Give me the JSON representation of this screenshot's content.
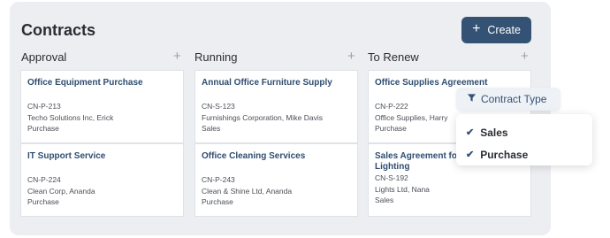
{
  "title": "Contracts",
  "create_label": "Create",
  "columns": [
    {
      "name": "Approval"
    },
    {
      "name": "Running"
    },
    {
      "name": "To Renew"
    }
  ],
  "cards": {
    "approval": [
      {
        "title": "Office Equipment Purchase",
        "id": "CN-P-213",
        "party": "Techo Solutions Inc, Erick",
        "type": "Purchase"
      },
      {
        "title": "IT Support Service",
        "id": "CN-P-224",
        "party": "Clean Corp, Ananda",
        "type": "Purchase"
      }
    ],
    "running": [
      {
        "title": "Annual Office Furniture Supply",
        "id": "CN-S-123",
        "party": "Furnishings Corporation, Mike Davis",
        "type": "Sales"
      },
      {
        "title": "Office Cleaning Services",
        "id": "CN-P-243",
        "party": "Clean & Shine Ltd, Ananda",
        "type": "Purchase"
      }
    ],
    "renew": [
      {
        "title": "Office Supplies Agreement",
        "id": "CN-P-222",
        "party": "Office Supplies, Harry",
        "type": "Purchase"
      },
      {
        "title_line1": "Sales Agreement fo",
        "title_line2": "Lighting",
        "id": "CN-S-192",
        "party": "Lights Ltd, Nana",
        "type": "Sales"
      }
    ]
  },
  "filter": {
    "label": "Contract Type",
    "options": [
      {
        "label": "Sales",
        "checked": true
      },
      {
        "label": "Purchase",
        "checked": true
      }
    ]
  }
}
